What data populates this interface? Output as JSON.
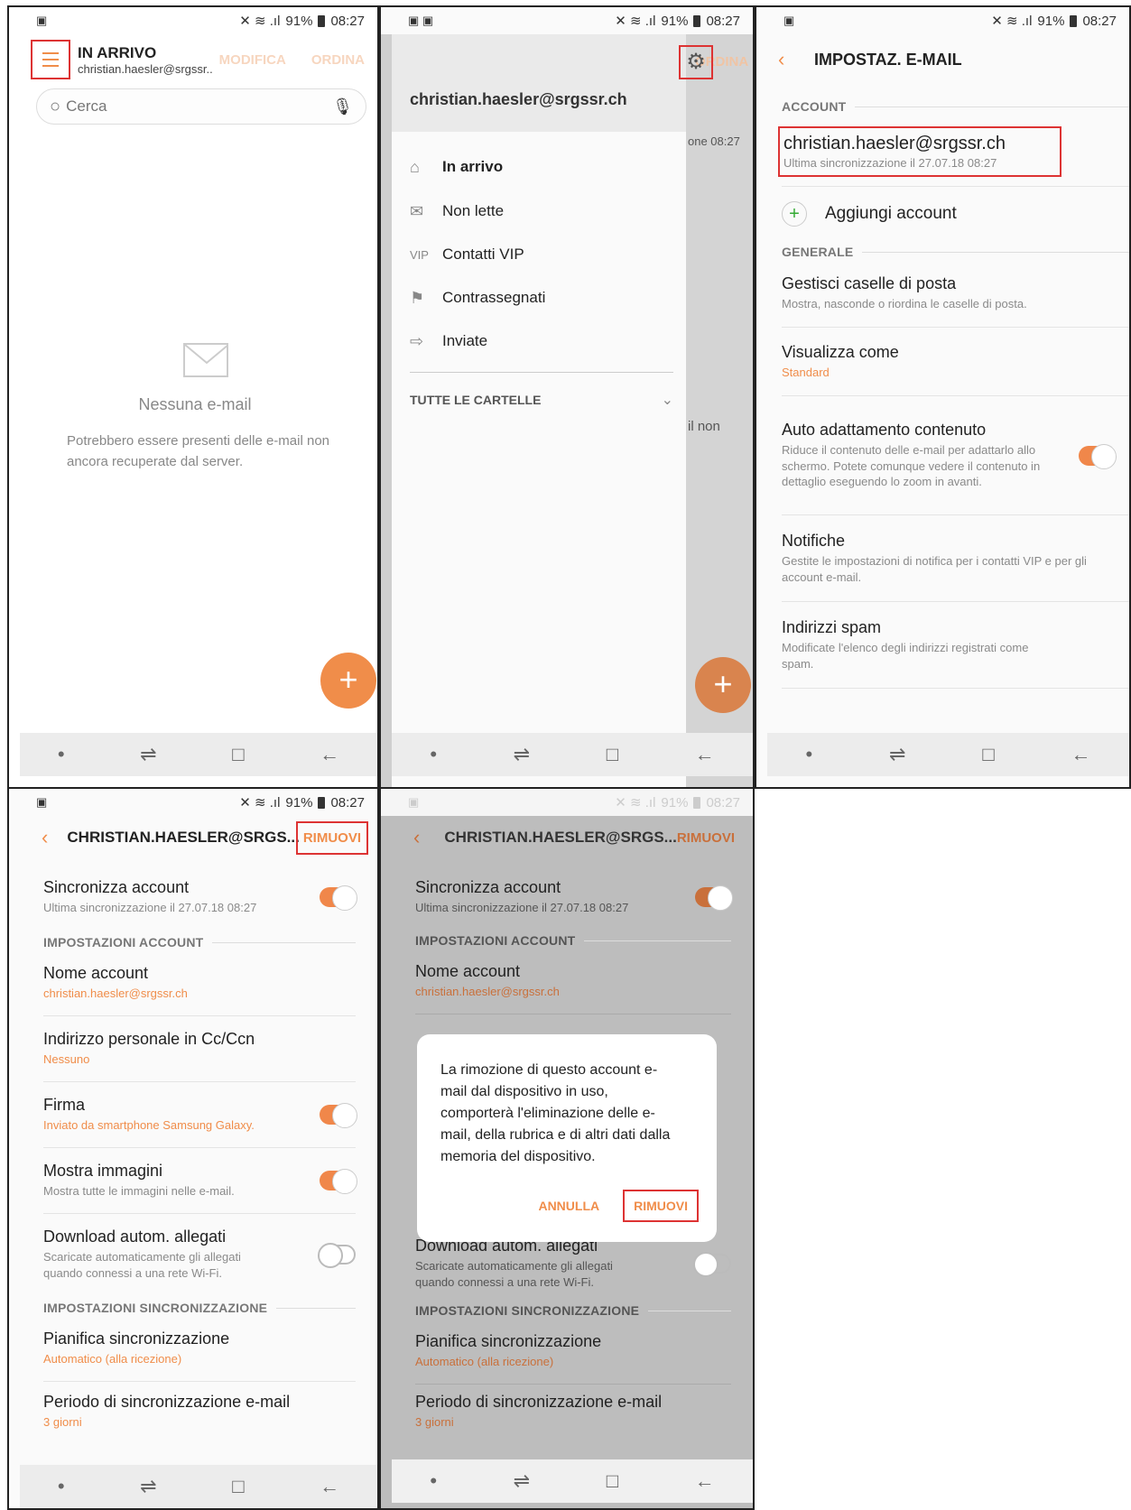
{
  "status": {
    "battery": "91%",
    "time": "08:27"
  },
  "p1": {
    "title": "IN ARRIVO",
    "account": "christian.haesler@srgssr..",
    "modifica": "MODIFICA",
    "ordina": "ORDINA",
    "search_placeholder": "Cerca",
    "empty_title": "Nessuna e-mail",
    "empty_text": "Potrebbero essere presenti delle e-mail non ancora recuperate dal server."
  },
  "p2": {
    "account": "christian.haesler@srgssr.ch",
    "ordina": "ORDINA",
    "items": [
      {
        "icon": "inbox-icon",
        "label": "In arrivo"
      },
      {
        "icon": "unread-mail-icon",
        "label": "Non lette"
      },
      {
        "icon": "vip-icon",
        "label": "Contatti VIP"
      },
      {
        "icon": "flag-icon",
        "label": "Contrassegnati"
      },
      {
        "icon": "sent-icon",
        "label": "Inviate"
      }
    ],
    "all_folders": "TUTTE LE CARTELLE",
    "bg_time": "one  08:27",
    "bg_text": "il non",
    "vip_glyph": "VIP"
  },
  "p3": {
    "title": "IMPOSTAZ. E-MAIL",
    "section_account": "ACCOUNT",
    "account_email": "christian.haesler@srgssr.ch",
    "account_sync": "Ultima sincronizzazione il 27.07.18  08:27",
    "add_account": "Aggiungi account",
    "section_general": "GENERALE",
    "rows": [
      {
        "title": "Gestisci caselle di posta",
        "sub": "Mostra, nasconde o riordina le caselle di posta.",
        "orange": false,
        "toggle": null
      },
      {
        "title": "Visualizza come",
        "sub": "Standard",
        "orange": true,
        "toggle": null
      },
      {
        "title": "Auto adattamento contenuto",
        "sub": "Riduce il contenuto delle e-mail per adattarlo allo schermo. Potete comunque vedere il contenuto in dettaglio eseguendo lo zoom in avanti.",
        "orange": false,
        "toggle": "on"
      },
      {
        "title": "Notifiche",
        "sub": "Gestite le impostazioni di notifica per i contatti VIP e per gli account e-mail.",
        "orange": false,
        "toggle": null
      },
      {
        "title": "Indirizzi spam",
        "sub": "Modificate l'elenco degli indirizzi registrati come spam.",
        "orange": false,
        "toggle": null
      }
    ]
  },
  "p4": {
    "title": "CHRISTIAN.HAESLER@SRGS...",
    "remove": "RIMUOVI",
    "sync_title": "Sincronizza account",
    "sync_sub": "Ultima sincronizzazione il 27.07.18  08:27",
    "section_account": "IMPOSTAZIONI ACCOUNT",
    "rows": [
      {
        "title": "Nome account",
        "sub": "christian.haesler@srgssr.ch",
        "orange": true,
        "toggle": null
      },
      {
        "title": "Indirizzo personale in Cc/Ccn",
        "sub": "Nessuno",
        "orange": true,
        "toggle": null
      },
      {
        "title": "Firma",
        "sub": "Inviato da smartphone Samsung Galaxy.",
        "orange": true,
        "toggle": "on"
      },
      {
        "title": "Mostra immagini",
        "sub": "Mostra tutte le immagini nelle e-mail.",
        "orange": false,
        "toggle": "on"
      },
      {
        "title": "Download autom. allegati",
        "sub": "Scaricate automaticamente gli allegati quando connessi a una rete Wi-Fi.",
        "orange": false,
        "toggle": "off"
      }
    ],
    "section_sync": "IMPOSTAZIONI SINCRONIZZAZIONE",
    "sync_rows": [
      {
        "title": "Pianifica sincronizzazione",
        "sub": "Automatico (alla ricezione)"
      },
      {
        "title": "Periodo di sincronizzazione e-mail",
        "sub": "3 giorni"
      }
    ]
  },
  "p5": {
    "title": "CHRISTIAN.HAESLER@SRGS...",
    "remove": "RIMUOVI",
    "dialog_text": "La rimozione di questo account e-mail dal dispositivo in uso, comporterà l'eliminazione delle e-mail, della rubrica e di altri dati dalla memoria del dispositivo.",
    "cancel": "ANNULLA",
    "confirm": "RIMUOVI"
  }
}
